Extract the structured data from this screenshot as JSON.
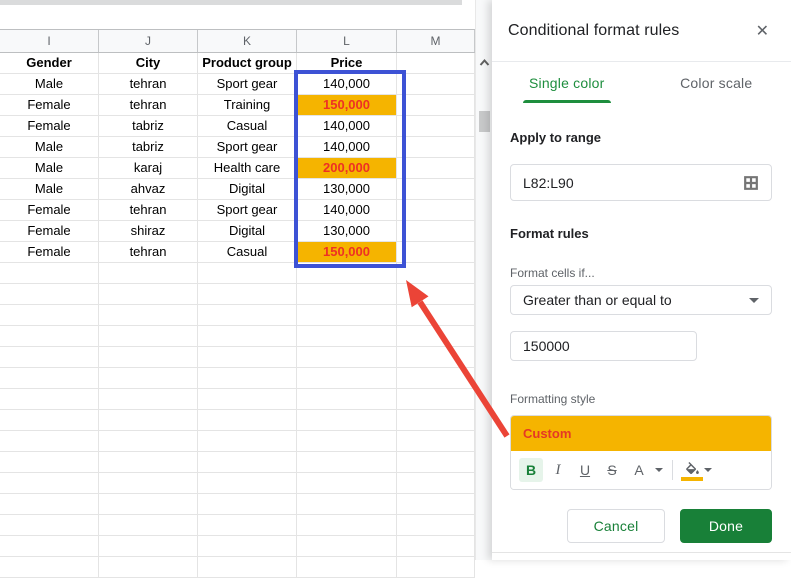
{
  "sheet": {
    "columns": [
      "I",
      "J",
      "K",
      "L",
      "M"
    ],
    "header_row": [
      "Gender",
      "City",
      "Product group",
      "Price"
    ],
    "rows": [
      {
        "gender": "Male",
        "city": "tehran",
        "product": "Sport gear",
        "price": "140,000",
        "highlight": false
      },
      {
        "gender": "Female",
        "city": "tehran",
        "product": "Training",
        "price": "150,000",
        "highlight": true
      },
      {
        "gender": "Female",
        "city": "tabriz",
        "product": "Casual",
        "price": "140,000",
        "highlight": false
      },
      {
        "gender": "Male",
        "city": "tabriz",
        "product": "Sport gear",
        "price": "140,000",
        "highlight": false
      },
      {
        "gender": "Male",
        "city": "karaj",
        "product": "Health care",
        "price": "200,000",
        "highlight": true
      },
      {
        "gender": "Male",
        "city": "ahvaz",
        "product": "Digital",
        "price": "130,000",
        "highlight": false
      },
      {
        "gender": "Female",
        "city": "tehran",
        "product": "Sport gear",
        "price": "140,000",
        "highlight": false
      },
      {
        "gender": "Female",
        "city": "shiraz",
        "product": "Digital",
        "price": "130,000",
        "highlight": false
      },
      {
        "gender": "Female",
        "city": "tehran",
        "product": "Casual",
        "price": "150,000",
        "highlight": true
      }
    ]
  },
  "panel": {
    "title": "Conditional format rules",
    "close_icon": "✕",
    "tabs": [
      {
        "label": "Single color",
        "active": true
      },
      {
        "label": "Color scale",
        "active": false
      }
    ],
    "apply_to_range": {
      "label": "Apply to range",
      "value": "L82:L90"
    },
    "format_rules": {
      "heading": "Format rules",
      "condition_label": "Format cells if...",
      "condition_value": "Greater than or equal to",
      "condition_input": "150000"
    },
    "formatting_style": {
      "label": "Formatting style",
      "preview_text": "Custom",
      "toolbar": {
        "bold": "B",
        "italic": "I",
        "underline": "U",
        "strikethrough": "S",
        "text_color": "A"
      }
    },
    "buttons": {
      "cancel": "Cancel",
      "done": "Done"
    }
  },
  "colors": {
    "accent_green": "#188038",
    "tab_green": "#1E8E3E",
    "highlight_orange": "#F5B400",
    "highlight_text_red": "#EE3124",
    "selection_blue": "#3D52D5",
    "arrow_red": "#EB4437"
  }
}
